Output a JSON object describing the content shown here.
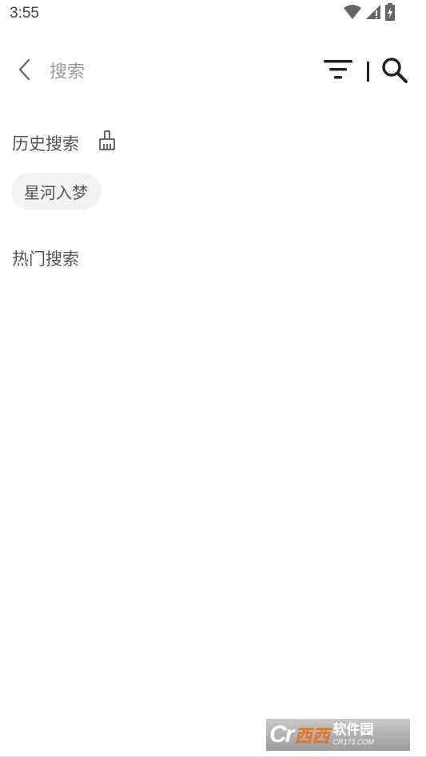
{
  "status_bar": {
    "time": "3:55",
    "icons": [
      "wifi-icon",
      "cell-signal-icon",
      "battery-charging-icon"
    ]
  },
  "search": {
    "placeholder": "搜索",
    "value": "",
    "icons": {
      "back": "chevron-left-icon",
      "filter": "filter-icon",
      "search": "search-icon"
    }
  },
  "history": {
    "title": "历史搜索",
    "clear_icon": "broom-icon",
    "items": [
      "星河入梦"
    ]
  },
  "hot": {
    "title": "热门搜索",
    "items": []
  },
  "watermark": {
    "logo_text": "Cr",
    "brand": "西西",
    "site": "软件园",
    "domain": "CR173.COM"
  },
  "colors": {
    "background": "#ffffff",
    "chip_background": "#f2f2f2",
    "text_primary": "#555555",
    "placeholder": "#9a9a9a",
    "icon_dark": "#222222",
    "watermark_orange": "#e8731e"
  }
}
